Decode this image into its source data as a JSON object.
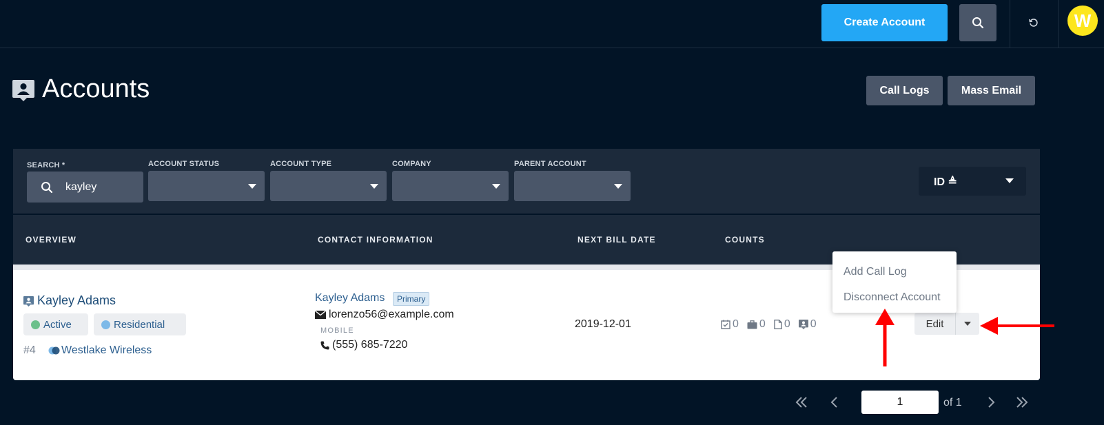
{
  "topbar": {
    "create_label": "Create Account",
    "avatar_letter": "W",
    "icons": {
      "search": "search-icon",
      "refresh": "refresh-icon"
    }
  },
  "page": {
    "title": "Accounts",
    "call_logs_label": "Call Logs",
    "mass_email_label": "Mass Email"
  },
  "filters": {
    "search_label": "SEARCH *",
    "search_value": "kayley",
    "status_label": "ACCOUNT STATUS",
    "type_label": "ACCOUNT TYPE",
    "company_label": "COMPANY",
    "parent_label": "PARENT ACCOUNT",
    "sort_label": "ID ≜"
  },
  "table": {
    "columns": [
      "OVERVIEW",
      "CONTACT INFORMATION",
      "NEXT BILL DATE",
      "COUNTS"
    ],
    "rows": [
      {
        "name": "Kayley Adams",
        "status": "Active",
        "status_color": "#6cc08b",
        "type": "Residential",
        "type_color": "#7db9e8",
        "id": "#4",
        "company": "Westlake Wireless",
        "contact_name": "Kayley Adams",
        "contact_badge": "Primary",
        "email": "lorenzo56@example.com",
        "mobile_label": "MOBILE",
        "phone": "(555) 685-7220",
        "next_bill_date": "2019-12-01",
        "counts": {
          "tasks": "0",
          "cases": "0",
          "documents": "0",
          "call_logs": "0"
        },
        "edit_label": "Edit"
      }
    ]
  },
  "menu": {
    "items": [
      "Add Call Log",
      "Disconnect Account"
    ]
  },
  "pagination": {
    "current": "1",
    "of_label": "of 1"
  },
  "colors": {
    "background": "#021426",
    "accent": "#23a7f5",
    "panel": "#1c2a3b",
    "annotation": "#ff0000"
  }
}
